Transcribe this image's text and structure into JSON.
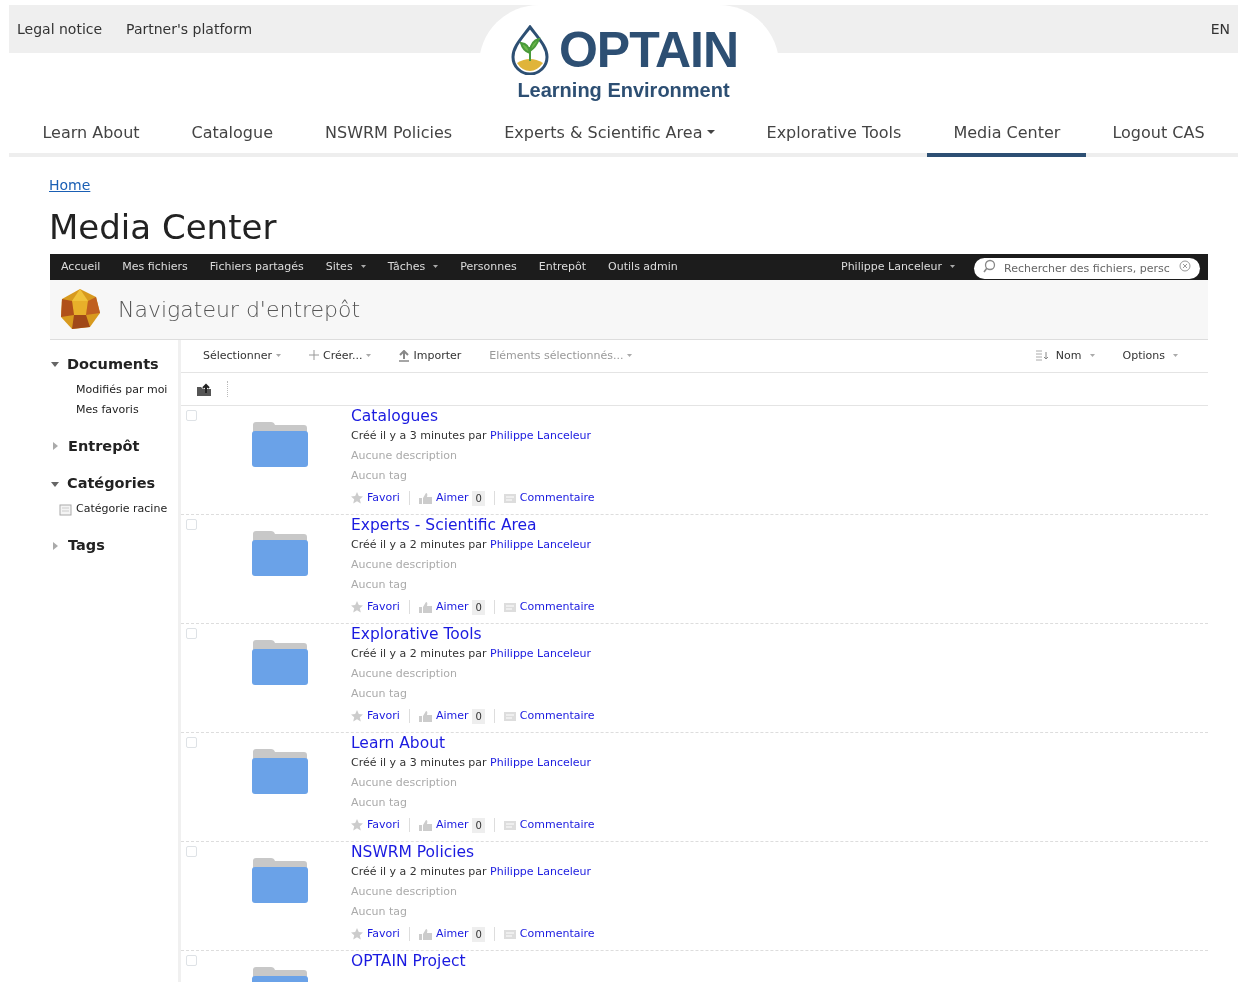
{
  "top_links": [
    "Legal notice",
    "Partner's platform"
  ],
  "language": "EN",
  "logo": {
    "name": "OPTAIN",
    "subtitle": "Learning Environment"
  },
  "main_nav": [
    {
      "label": "Learn About",
      "selected": false,
      "dropdown": false
    },
    {
      "label": "Catalogue",
      "selected": false,
      "dropdown": false
    },
    {
      "label": "NSWRM Policies",
      "selected": false,
      "dropdown": false
    },
    {
      "label": "Experts & Scientific Area",
      "selected": false,
      "dropdown": true
    },
    {
      "label": "Explorative Tools",
      "selected": false,
      "dropdown": false
    },
    {
      "label": "Media Center",
      "selected": true,
      "dropdown": false
    },
    {
      "label": "Logout CAS",
      "selected": false,
      "dropdown": false
    }
  ],
  "breadcrumb": "Home",
  "page_title": "Media Center",
  "app_menu": [
    {
      "label": "Accueil",
      "dropdown": false
    },
    {
      "label": "Mes fichiers",
      "dropdown": false
    },
    {
      "label": "Fichiers partagés",
      "dropdown": false
    },
    {
      "label": "Sites",
      "dropdown": true
    },
    {
      "label": "Tâches",
      "dropdown": true
    },
    {
      "label": "Personnes",
      "dropdown": false
    },
    {
      "label": "Entrepôt",
      "dropdown": false
    },
    {
      "label": "Outils admin",
      "dropdown": false
    }
  ],
  "user_menu": "Philippe Lanceleur",
  "search": {
    "placeholder": "Rechercher des fichiers, persc"
  },
  "app_title": "Navigateur d'entrepôt",
  "sidebar": [
    {
      "label": "Documents",
      "expanded": true,
      "children": [
        {
          "label": "Modifiés par moi",
          "kind": "plain"
        },
        {
          "label": "Mes favoris",
          "kind": "plain"
        }
      ]
    },
    {
      "label": "Entrepôt",
      "expanded": false
    },
    {
      "label": "Catégories",
      "expanded": true,
      "children": [
        {
          "label": "Catégorie racine",
          "kind": "category"
        }
      ]
    },
    {
      "label": "Tags",
      "expanded": false
    }
  ],
  "toolbar": {
    "left": [
      {
        "label": "Sélectionner",
        "kind": "menu",
        "disabled": false
      },
      {
        "label": "Créer...",
        "kind": "create",
        "disabled": false
      },
      {
        "label": "Importer",
        "kind": "upload",
        "disabled": false
      },
      {
        "label": "Eléments sélectionnés...",
        "kind": "menu",
        "disabled": true
      }
    ],
    "sort": "Nom",
    "options": "Options"
  },
  "folders": [
    {
      "title": "Catalogues",
      "checked": false,
      "created": "Créé il y a 3 minutes par",
      "author": "Philippe Lanceleur",
      "description": "Aucune description",
      "tags": "Aucun tag",
      "favorite": "Favori",
      "like": "Aimer",
      "likes": "0",
      "comment": "Commentaire"
    },
    {
      "title": "Experts - Scientific Area",
      "checked": false,
      "created": "Créé il y a 2 minutes par",
      "author": "Philippe Lanceleur",
      "description": "Aucune description",
      "tags": "Aucun tag",
      "favorite": "Favori",
      "like": "Aimer",
      "likes": "0",
      "comment": "Commentaire"
    },
    {
      "title": "Explorative Tools",
      "checked": false,
      "created": "Créé il y a 2 minutes par",
      "author": "Philippe Lanceleur",
      "description": "Aucune description",
      "tags": "Aucun tag",
      "favorite": "Favori",
      "like": "Aimer",
      "likes": "0",
      "comment": "Commentaire"
    },
    {
      "title": "Learn About",
      "checked": false,
      "created": "Créé il y a 3 minutes par",
      "author": "Philippe Lanceleur",
      "description": "Aucune description",
      "tags": "Aucun tag",
      "favorite": "Favori",
      "like": "Aimer",
      "likes": "0",
      "comment": "Commentaire"
    },
    {
      "title": "NSWRM Policies",
      "checked": false,
      "created": "Créé il y a 2 minutes par",
      "author": "Philippe Lanceleur",
      "description": "Aucune description",
      "tags": "Aucun tag",
      "favorite": "Favori",
      "like": "Aimer",
      "likes": "0",
      "comment": "Commentaire"
    },
    {
      "title": "OPTAIN Project",
      "checked": false
    }
  ]
}
